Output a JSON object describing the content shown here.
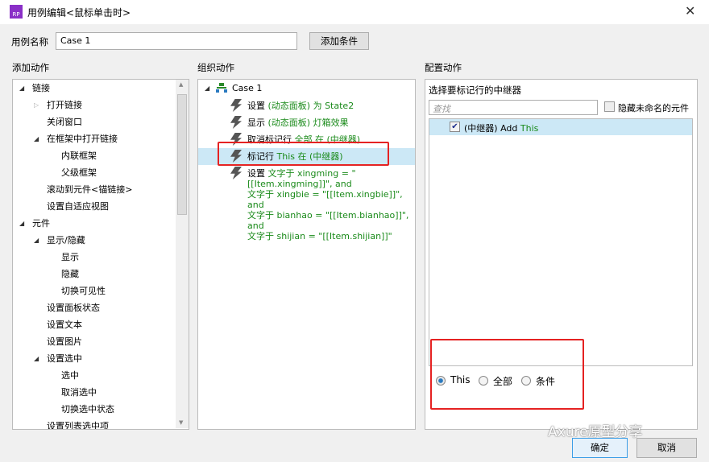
{
  "window": {
    "title": "用例编辑<鼠标单击时>",
    "logo": "RP"
  },
  "case_name": {
    "label": "用例名称",
    "value": "Case 1"
  },
  "add_condition": "添加条件",
  "sections": {
    "add_action": "添加动作",
    "organize": "组织动作",
    "configure": "配置动作"
  },
  "action_tree": [
    {
      "label": "链接",
      "level": 0,
      "toggle": "expanded"
    },
    {
      "label": "打开链接",
      "level": 1,
      "toggle": "collapsed"
    },
    {
      "label": "关闭窗口",
      "level": 1,
      "toggle": ""
    },
    {
      "label": "在框架中打开链接",
      "level": 1,
      "toggle": "expanded"
    },
    {
      "label": "内联框架",
      "level": 2,
      "toggle": ""
    },
    {
      "label": "父级框架",
      "level": 2,
      "toggle": ""
    },
    {
      "label": "滚动到元件<锚链接>",
      "level": 1,
      "toggle": ""
    },
    {
      "label": "设置自适应视图",
      "level": 1,
      "toggle": ""
    },
    {
      "label": "元件",
      "level": 0,
      "toggle": "expanded"
    },
    {
      "label": "显示/隐藏",
      "level": 1,
      "toggle": "expanded"
    },
    {
      "label": "显示",
      "level": 2,
      "toggle": ""
    },
    {
      "label": "隐藏",
      "level": 2,
      "toggle": ""
    },
    {
      "label": "切换可见性",
      "level": 2,
      "toggle": ""
    },
    {
      "label": "设置面板状态",
      "level": 1,
      "toggle": ""
    },
    {
      "label": "设置文本",
      "level": 1,
      "toggle": ""
    },
    {
      "label": "设置图片",
      "level": 1,
      "toggle": ""
    },
    {
      "label": "设置选中",
      "level": 1,
      "toggle": "expanded"
    },
    {
      "label": "选中",
      "level": 2,
      "toggle": ""
    },
    {
      "label": "取消选中",
      "level": 2,
      "toggle": ""
    },
    {
      "label": "切换选中状态",
      "level": 2,
      "toggle": ""
    },
    {
      "label": "设置列表选中项",
      "level": 1,
      "toggle": ""
    }
  ],
  "case": {
    "label": "Case 1"
  },
  "actions": [
    {
      "lines": [
        [
          {
            "t": "设置 ",
            "c": "k"
          },
          {
            "t": "(动态面板) 为 State2",
            "c": "g"
          }
        ]
      ],
      "selected": false
    },
    {
      "lines": [
        [
          {
            "t": "显示 ",
            "c": "k"
          },
          {
            "t": "(动态面板) 灯箱效果",
            "c": "g"
          }
        ]
      ],
      "selected": false
    },
    {
      "lines": [
        [
          {
            "t": "取消标记行 ",
            "c": "k"
          },
          {
            "t": "全部 在 (中继器)",
            "c": "g"
          }
        ]
      ],
      "selected": false
    },
    {
      "lines": [
        [
          {
            "t": "标记行 ",
            "c": "k"
          },
          {
            "t": "This 在 (中继器)",
            "c": "g"
          }
        ]
      ],
      "selected": true
    },
    {
      "lines": [
        [
          {
            "t": "设置 ",
            "c": "k"
          },
          {
            "t": "文字于 xingming = \"[[Item.xingming]]\", and",
            "c": "g"
          }
        ],
        [
          {
            "t": " 文字于 xingbie = \"[[Item.xingbie]]\", and",
            "c": "g"
          }
        ],
        [
          {
            "t": " 文字于 bianhao = \"[[Item.bianhao]]\", and",
            "c": "g"
          }
        ],
        [
          {
            "t": " 文字于 shijian = \"[[Item.shijian]]\"",
            "c": "g"
          }
        ]
      ],
      "selected": false
    }
  ],
  "config": {
    "heading": "选择要标记行的中继器",
    "search_placeholder": "查找",
    "hide_unnamed": "隐藏未命名的元件",
    "hide_unnamed_checked": false,
    "repeater_item": {
      "prefix": "(中继器) Add ",
      "target": "This",
      "checked": true
    },
    "radios": [
      {
        "label": "This",
        "selected": true
      },
      {
        "label": "全部",
        "selected": false
      },
      {
        "label": "条件",
        "selected": false
      }
    ]
  },
  "buttons": {
    "ok": "确定",
    "cancel": "取消"
  },
  "watermark": "Axure原型分享",
  "colors": {
    "green": "#1a8a1a",
    "selection": "#cce8f6",
    "highlight_box": "#e52222"
  }
}
